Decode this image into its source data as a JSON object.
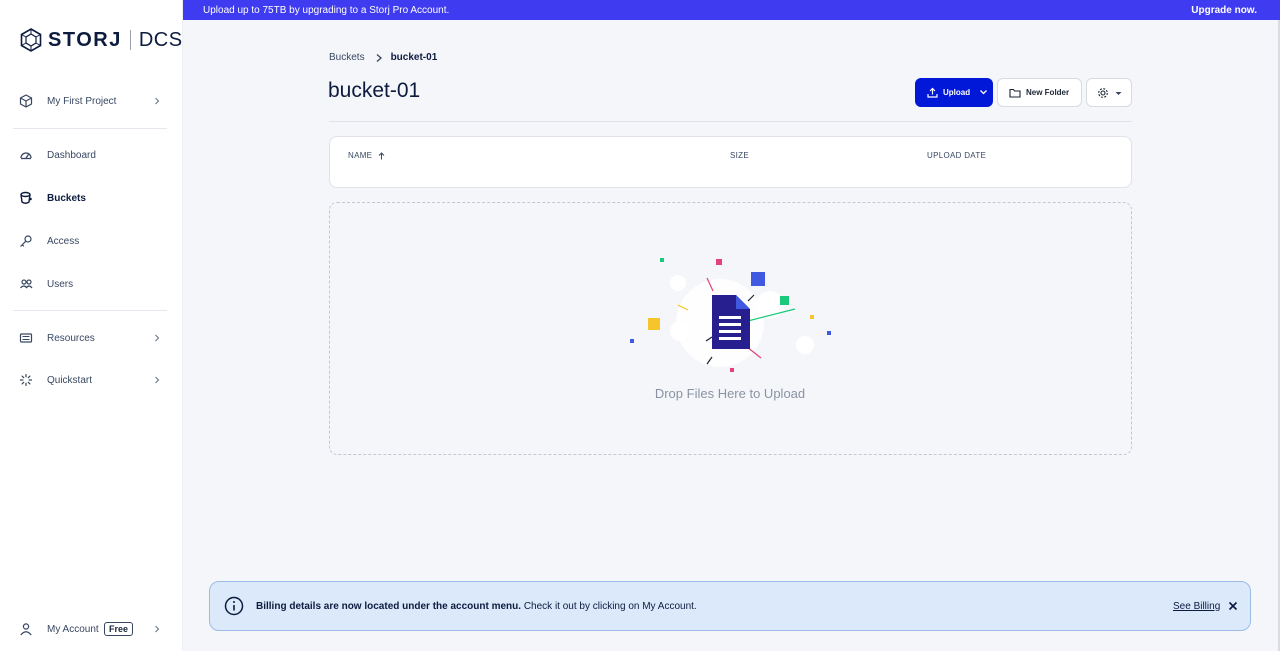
{
  "banner": {
    "text": "Upload up to 75TB by upgrading to a Storj Pro Account.",
    "link": "Upgrade now."
  },
  "sidebar": {
    "logo": {
      "brand": "STORJ",
      "product": "DCS"
    },
    "project": "My First Project",
    "items": [
      {
        "label": "Dashboard",
        "icon": "dashboard-icon"
      },
      {
        "label": "Buckets",
        "icon": "bucket-icon",
        "active": true
      },
      {
        "label": "Access",
        "icon": "key-icon"
      },
      {
        "label": "Users",
        "icon": "users-icon"
      }
    ],
    "resources": "Resources",
    "quickstart": "Quickstart",
    "account": {
      "label": "My Account",
      "badge": "Free"
    }
  },
  "breadcrumb": {
    "root": "Buckets",
    "current": "bucket-01"
  },
  "page": {
    "title": "bucket-01"
  },
  "toolbar": {
    "upload_label": "Upload",
    "new_folder_label": "New Folder"
  },
  "table": {
    "columns": {
      "name": "NAME",
      "size": "SIZE",
      "date": "UPLOAD DATE"
    }
  },
  "dropzone": {
    "text": "Drop Files Here to Upload"
  },
  "toast": {
    "bold": "Billing details are now located under the account menu.",
    "text": " Check it out by clicking on My Account.",
    "link": "See Billing"
  },
  "colors": {
    "accent": "#0218d9",
    "banner": "#3f3bf0",
    "toast_bg": "#dbe9fb"
  }
}
